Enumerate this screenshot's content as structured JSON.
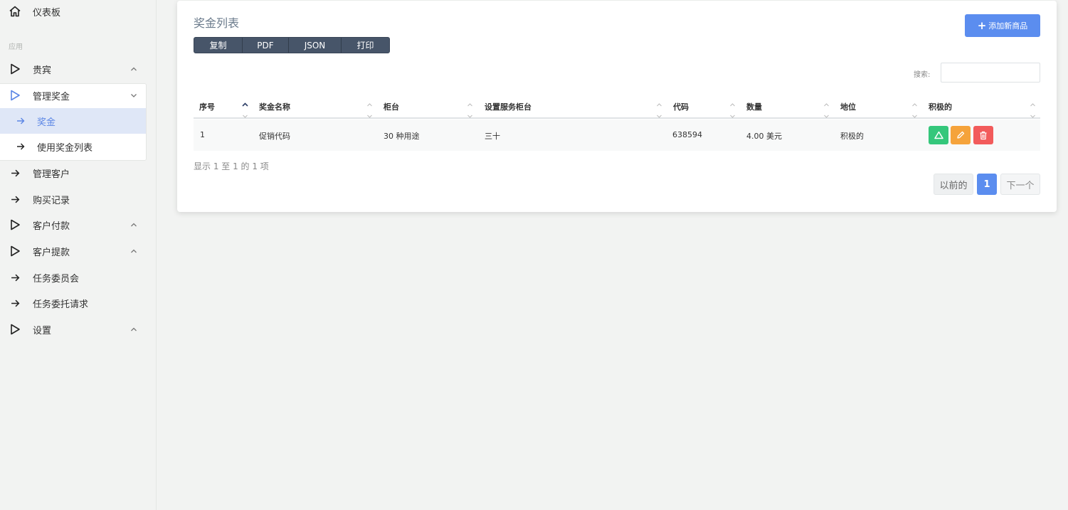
{
  "sidebar": {
    "dashboard": "仪表板",
    "section_label": "应用",
    "items": [
      {
        "label": "贵宾"
      },
      {
        "label": "管理奖金"
      },
      {
        "label": "奖金"
      },
      {
        "label": "使用奖金列表"
      },
      {
        "label": "管理客户"
      },
      {
        "label": "购买记录"
      },
      {
        "label": "客户付款"
      },
      {
        "label": "客户提款"
      },
      {
        "label": "任务委员会"
      },
      {
        "label": "任务委托请求"
      },
      {
        "label": "设置"
      }
    ]
  },
  "card": {
    "title": "奖金列表",
    "export_buttons": [
      "复制",
      "PDF",
      "JSON",
      "打印"
    ],
    "add_button": "添加新商品",
    "search_label": "搜索:",
    "search_value": ""
  },
  "table": {
    "headers": [
      "序号",
      "奖金名称",
      "柜台",
      "设置服务柜台",
      "代码",
      "数量",
      "地位",
      "积极的"
    ],
    "rows": [
      {
        "no": "1",
        "name": "促销代码",
        "counter": "30 种用途",
        "service_counter": "三十",
        "code": "638594",
        "amount": "4.00 美元",
        "status": "积极的"
      }
    ]
  },
  "footer": {
    "info": "显示 1 至 1 的 1 项",
    "prev": "以前的",
    "current": "1",
    "next": "下一个"
  },
  "colors": {
    "primary": "#5b8def",
    "success": "#34c77b",
    "warning": "#f5a33b",
    "danger": "#f25b5b",
    "button_group": "#475569"
  }
}
